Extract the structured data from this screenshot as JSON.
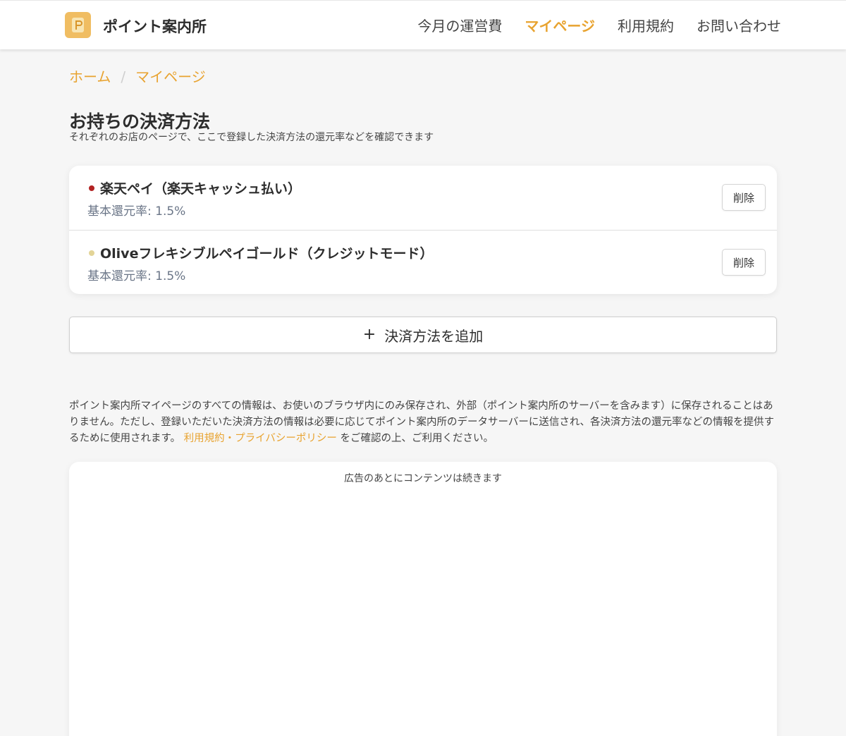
{
  "header": {
    "site_title": "ポイント案内所",
    "logo_icon": "p-logo-icon",
    "nav": [
      {
        "label": "今月の運営費",
        "active": false
      },
      {
        "label": "マイページ",
        "active": true
      },
      {
        "label": "利用規約",
        "active": false
      },
      {
        "label": "お問い合わせ",
        "active": false
      }
    ]
  },
  "breadcrumb": {
    "home": "ホーム",
    "separator": "/",
    "current": "マイページ"
  },
  "main": {
    "title": "お持ちの決済方法",
    "subtitle": "それぞれのお店のページで、ここで登録した決済方法の還元率などを確認できます",
    "payment_methods": [
      {
        "name": "楽天ペイ（楽天キャッシュ払い）",
        "rate": "基本還元率: 1.5%",
        "dot_color": "#b22222",
        "delete_label": "削除"
      },
      {
        "name": "Oliveフレキシブルペイゴールド（クレジットモード）",
        "rate": "基本還元率: 1.5%",
        "dot_color": "#e3d497",
        "delete_label": "削除"
      }
    ],
    "add_button_label": "決済方法を追加",
    "notice_text_1": "ポイント案内所マイページのすべての情報は、お使いのブラウザ内にのみ保存され、外部（ポイント案内所のサーバーを含みます）に保存されることはありません。ただし、登録いただいた決済方法の情報は必要に応じてポイント案内所のデータサーバーに送信され、各決済方法の還元率などの情報を提供するために使用されます。",
    "notice_link": "利用規約・プライバシーポリシー",
    "notice_text_2": "をご確認の上、ご利用ください。",
    "ad_label": "広告のあとにコンテンツは続きます"
  },
  "colors": {
    "accent": "#e8a330",
    "background": "#f6f6f6"
  }
}
